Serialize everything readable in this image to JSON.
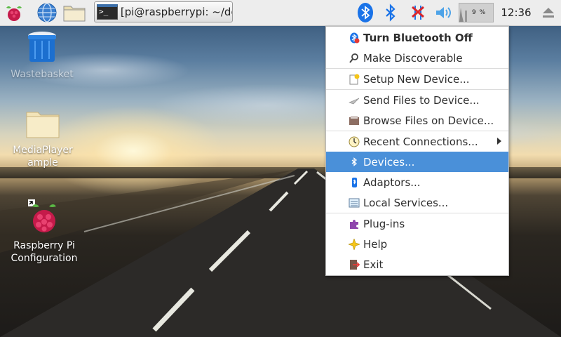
{
  "taskbar": {
    "task_label": "[pi@raspberrypi: ~/de...",
    "terminal_glyph": ">_",
    "clock": "12:36",
    "cpu_text": "9 %"
  },
  "desktop_icons": [
    {
      "label": "Wastebasket"
    },
    {
      "label": "MediaPlayer ample"
    },
    {
      "label": "Raspberry Pi Configuration"
    }
  ],
  "menu": {
    "items": [
      {
        "label": "Turn Bluetooth Off",
        "icon": "bluetooth-off-icon"
      },
      {
        "label": "Make Discoverable",
        "icon": "magnifier-icon"
      },
      {
        "label": "Setup New Device...",
        "icon": "new-device-icon"
      },
      {
        "label": "Send Files to Device...",
        "icon": "send-files-icon"
      },
      {
        "label": "Browse Files on Device...",
        "icon": "browse-files-icon"
      },
      {
        "label": "Recent Connections...",
        "icon": "recent-icon"
      },
      {
        "label": "Devices...",
        "icon": "bluetooth-icon"
      },
      {
        "label": "Adaptors...",
        "icon": "adaptor-icon"
      },
      {
        "label": "Local Services...",
        "icon": "services-icon"
      },
      {
        "label": "Plug-ins",
        "icon": "puzzle-icon"
      },
      {
        "label": "Help",
        "icon": "help-icon"
      },
      {
        "label": "Exit",
        "icon": "exit-icon"
      }
    ]
  },
  "colors": {
    "highlight": "#4a90d9",
    "bluetooth": "#1a73e8",
    "taskbar": "#ededed"
  }
}
